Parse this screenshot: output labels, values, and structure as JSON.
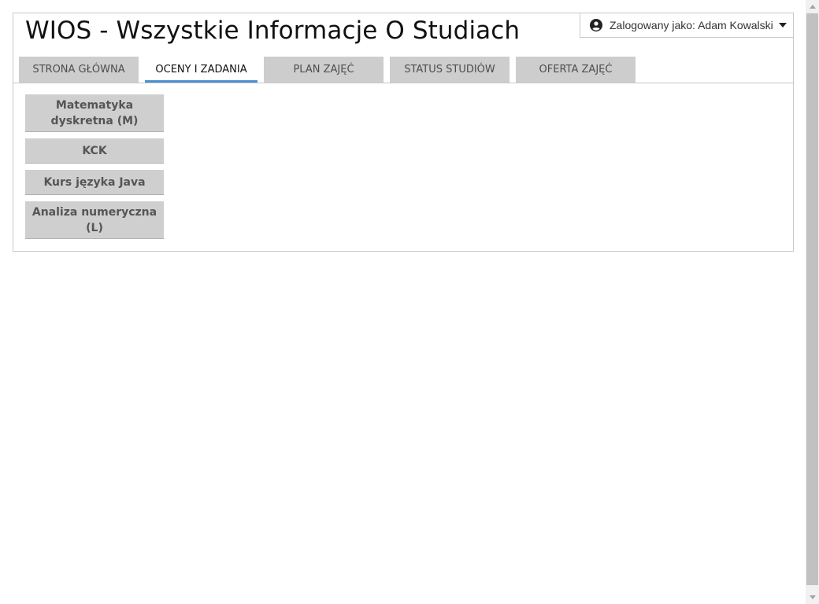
{
  "header": {
    "title": "WIOS - Wszystkie Informacje O Studiach",
    "user_label": "Zalogowany jako: Adam Kowalski",
    "user_icon": "user-circle-icon",
    "caret_icon": "caret-down-icon"
  },
  "tabs": [
    {
      "label": "STRONA GŁÓWNA",
      "active": false
    },
    {
      "label": "OCENY I ZADANIA",
      "active": true
    },
    {
      "label": "PLAN ZAJĘĆ",
      "active": false
    },
    {
      "label": "STATUS STUDIÓW",
      "active": false
    },
    {
      "label": "OFERTA ZAJĘĆ",
      "active": false
    }
  ],
  "subjects": [
    {
      "label": "Matematyka dyskretna (M)"
    },
    {
      "label": "KCK"
    },
    {
      "label": "Kurs języka Java"
    },
    {
      "label": "Analiza numeryczna (L)"
    }
  ],
  "colors": {
    "tab_active_underline": "#4a8fd1",
    "tab_background": "#cdcdcd",
    "subject_background": "#cfcfcf",
    "scrollbar_thumb": "#c1c1c1"
  }
}
